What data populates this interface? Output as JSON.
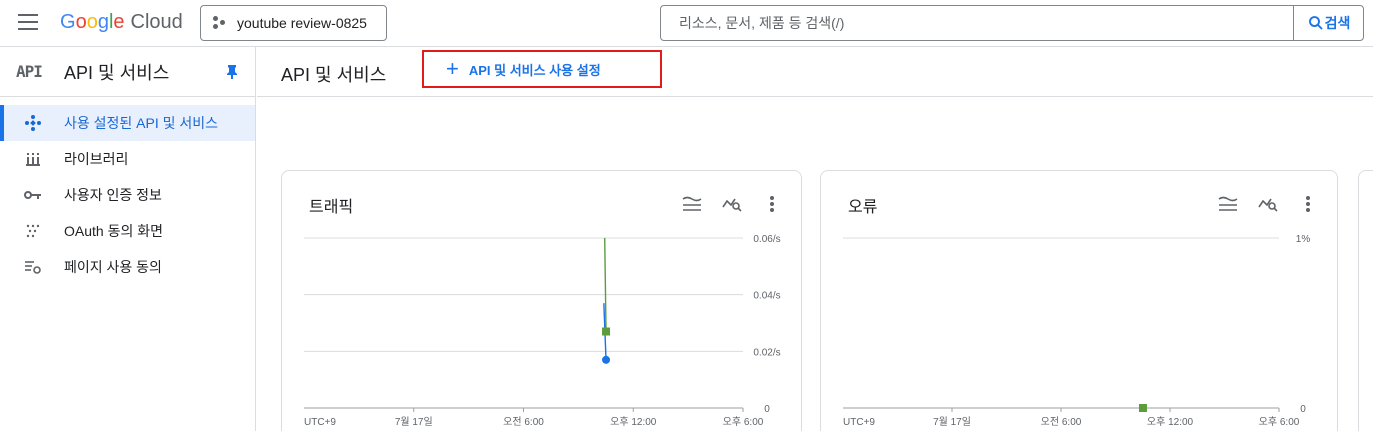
{
  "header": {
    "logo_google": "Google",
    "logo_cloud": "Cloud",
    "project": "youtube review-0825",
    "search_placeholder": "리소스, 문서, 제품 등 검색(/)",
    "search_button": "검색"
  },
  "sidebar": {
    "logo": "API",
    "title": "API 및 서비스",
    "items": [
      {
        "label": "사용 설정된 API 및 서비스",
        "icon": "api-diamond-icon",
        "active": true
      },
      {
        "label": "라이브러리",
        "icon": "library-icon",
        "active": false
      },
      {
        "label": "사용자 인증 정보",
        "icon": "key-icon",
        "active": false
      },
      {
        "label": "OAuth 동의 화면",
        "icon": "oauth-dots-icon",
        "active": false
      },
      {
        "label": "페이지 사용 동의",
        "icon": "settings-list-icon",
        "active": false
      }
    ]
  },
  "main": {
    "title": "API 및 서비스",
    "enable_button": "API 및 서비스 사용 설정"
  },
  "colors": {
    "accent": "#1a73e8",
    "highlight_border": "#e01b1b",
    "series_blue": "#1a73e8",
    "series_green": "#5d9c3d"
  },
  "chart_data": [
    {
      "type": "line",
      "title": "트래픽",
      "x_ticks": [
        "UTC+9",
        "7월 17일",
        "오전 6:00",
        "오후 12:00",
        "오후 6:00"
      ],
      "y_ticks": [
        "0",
        "0.02/s",
        "0.04/s",
        "0.06/s"
      ],
      "ylim": [
        0,
        0.06
      ],
      "series": [
        {
          "color": "#5d9c3d",
          "points": [
            [
              0.685,
              0.06
            ],
            [
              0.688,
              0.027
            ]
          ]
        },
        {
          "color": "#1a73e8",
          "points": [
            [
              0.683,
              0.037
            ],
            [
              0.688,
              0.017
            ]
          ]
        }
      ],
      "markers": [
        {
          "color": "#5d9c3d",
          "shape": "square",
          "x": 0.688,
          "y": 0.027
        },
        {
          "color": "#1a73e8",
          "shape": "circle",
          "x": 0.688,
          "y": 0.017
        }
      ]
    },
    {
      "type": "line",
      "title": "오류",
      "x_ticks": [
        "UTC+9",
        "7월 17일",
        "오전 6:00",
        "오후 12:00",
        "오후 6:00"
      ],
      "y_ticks": [
        "0",
        "1%"
      ],
      "ylim": [
        0,
        1
      ],
      "series": [],
      "markers": [
        {
          "color": "#5d9c3d",
          "shape": "square",
          "x": 0.688,
          "y": 0
        }
      ]
    }
  ]
}
